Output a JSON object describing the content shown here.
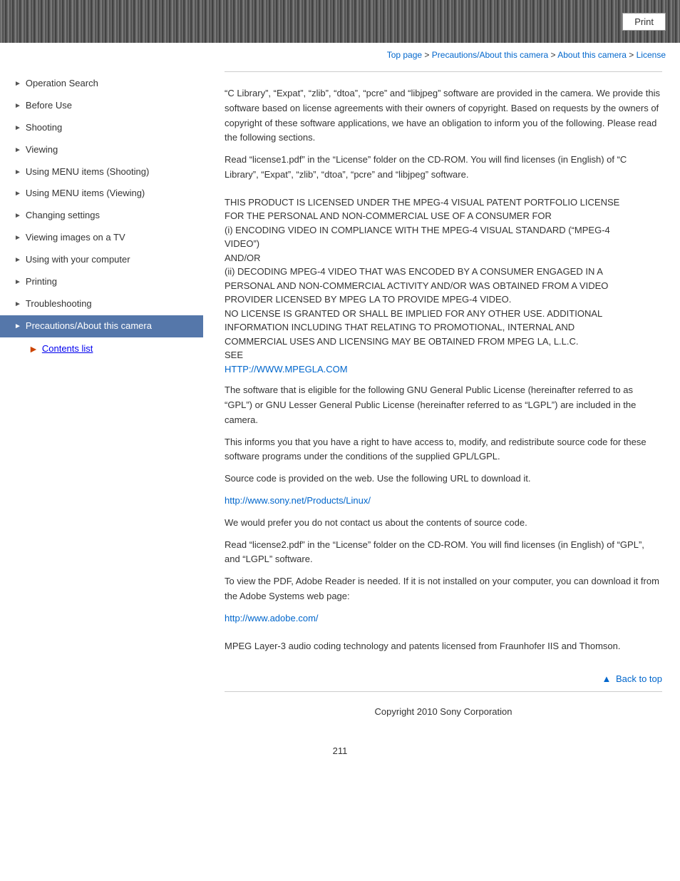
{
  "header": {
    "print_label": "Print"
  },
  "breadcrumb": {
    "items": [
      {
        "label": "Top page",
        "link": true
      },
      {
        "label": " > ",
        "link": false
      },
      {
        "label": "Precautions/About this camera",
        "link": true
      },
      {
        "label": " > ",
        "link": false
      },
      {
        "label": "About this camera",
        "link": true
      },
      {
        "label": " > ",
        "link": false
      },
      {
        "label": "License",
        "link": true
      }
    ]
  },
  "sidebar": {
    "items": [
      {
        "label": "Operation Search",
        "active": false
      },
      {
        "label": "Before Use",
        "active": false
      },
      {
        "label": "Shooting",
        "active": false
      },
      {
        "label": "Viewing",
        "active": false
      },
      {
        "label": "Using MENU items (Shooting)",
        "active": false
      },
      {
        "label": "Using MENU items (Viewing)",
        "active": false
      },
      {
        "label": "Changing settings",
        "active": false
      },
      {
        "label": "Viewing images on a TV",
        "active": false
      },
      {
        "label": "Using with your computer",
        "active": false
      },
      {
        "label": "Printing",
        "active": false
      },
      {
        "label": "Troubleshooting",
        "active": false
      },
      {
        "label": "Precautions/About this camera",
        "active": true
      }
    ],
    "contents_list": "Contents list"
  },
  "content": {
    "section1": {
      "para1": "“C Library”, “Expat”, “zlib”, “dtoa”, “pcre” and “libjpeg” software are provided in the camera. We provide this software based on license agreements with their owners of copyright. Based on requests by the owners of copyright of these software applications, we have an obligation to inform you of the following. Please read the following sections.",
      "para2": "Read “license1.pdf” in the “License” folder on the CD-ROM. You will find licenses (in English) of “C Library”, “Expat”, “zlib”, “dtoa”, “pcre” and “libjpeg” software."
    },
    "section2": {
      "line1": "THIS PRODUCT IS LICENSED UNDER THE MPEG-4 VISUAL PATENT PORTFOLIO LICENSE",
      "line2": "FOR THE PERSONAL AND NON-COMMERCIAL USE OF A CONSUMER FOR",
      "line3": "(i) ENCODING VIDEO IN COMPLIANCE WITH THE MPEG-4 VISUAL STANDARD (“MPEG-4",
      "line4": "VIDEO”)",
      "line5": "AND/OR",
      "line6": "(ii) DECODING MPEG-4 VIDEO THAT WAS ENCODED BY A CONSUMER ENGAGED IN A",
      "line7": "PERSONAL AND NON-COMMERCIAL ACTIVITY AND/OR WAS OBTAINED FROM A VIDEO",
      "line8": "PROVIDER LICENSED BY MPEG LA TO PROVIDE MPEG-4 VIDEO.",
      "line9": "NO LICENSE IS GRANTED OR SHALL BE IMPLIED FOR ANY OTHER USE. ADDITIONAL",
      "line10": "INFORMATION INCLUDING THAT RELATING TO PROMOTIONAL, INTERNAL AND",
      "line11": "COMMERCIAL USES AND LICENSING MAY BE OBTAINED FROM MPEG LA, L.L.C.",
      "line12": "SEE",
      "url1": "HTTP://WWW.MPEGLA.COM",
      "url1_href": "http://www.mpegla.com"
    },
    "section3": {
      "para1": "The software that is eligible for the following GNU General Public License (hereinafter referred to as “GPL”) or GNU Lesser General Public License (hereinafter referred to as “LGPL”) are included in the camera.",
      "para2": "This informs you that you have a right to have access to, modify, and redistribute source code for these software programs under the conditions of the supplied GPL/LGPL.",
      "para3": "Source code is provided on the web. Use the following URL to download it.",
      "url2": "http://www.sony.net/Products/Linux/",
      "url2_href": "http://www.sony.net/Products/Linux/",
      "para4": "We would prefer you do not contact us about the contents of source code.",
      "para5": "Read “license2.pdf” in the “License” folder on the CD-ROM. You will find licenses (in English) of “GPL”, and “LGPL” software.",
      "para6": "To view the PDF, Adobe Reader is needed. If it is not installed on your computer, you can download it from the Adobe Systems web page:",
      "url3": "http://www.adobe.com/",
      "url3_href": "http://www.adobe.com/"
    },
    "section4": {
      "para1": "MPEG Layer-3 audio coding technology and patents licensed from Fraunhofer IIS and Thomson."
    },
    "back_to_top": "Back to top",
    "footer": "Copyright 2010 Sony Corporation",
    "page_number": "211"
  }
}
